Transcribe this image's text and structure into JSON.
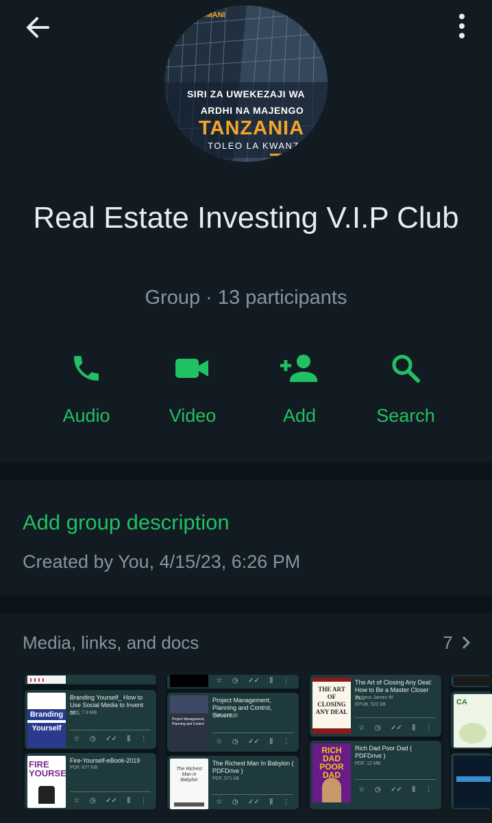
{
  "avatar": {
    "brand": "BOMANI",
    "line1": "SIRI ZA  UWEKEZAJI  WA",
    "line2": "ARDHI  NA MAJENGO",
    "line3": "TANZANIA",
    "line4": "TOLEO LA KWANZ"
  },
  "group": {
    "title": "Real Estate Investing V.I.P Club",
    "subtitle": "Group · 13 participants"
  },
  "actions": [
    {
      "label": "Audio",
      "icon": "phone-icon"
    },
    {
      "label": "Video",
      "icon": "video-camera-icon"
    },
    {
      "label": "Add",
      "icon": "add-person-icon"
    },
    {
      "label": "Search",
      "icon": "search-icon"
    }
  ],
  "description": {
    "add_label": "Add group description",
    "created": "Created by You, 4/15/23, 6:26 PM"
  },
  "media": {
    "title": "Media, links, and docs",
    "count": "7",
    "docs": [
      {
        "name": "Branding Yourself_ How to Use Social Media to Invent or...",
        "meta": "PDF, 7.9 MB",
        "cover_text": "Branding Yourself"
      },
      {
        "name": "Fire-Yourself-eBook-2019",
        "meta": "PDF, 677 KB",
        "cover_text": "FIRE YOURSELF"
      },
      {
        "name": "Project Management, Planning and Control, Sevent...",
        "meta": "PDF, 17 MB",
        "cover_text": "Project Management, Planning and Control"
      },
      {
        "name": "The Richest Man In Babylon ( PDFDrive )",
        "meta": "PDF, 571 kB",
        "cover_text": "The Richest Man in Babylon"
      },
      {
        "name": "The Art of Closing Any Deal: How to Be a Master Closer in...",
        "meta": "Pickens James W.",
        "meta2": "EPUB, 522 kB",
        "cover_text": "THE ART OF CLOSING ANY DEAL"
      },
      {
        "name": "Rich Dad Poor Dad ( PDFDrive )",
        "meta": "PDF, 12 MB",
        "cover_text": "RICH DAD POOR DAD"
      },
      {
        "name": "",
        "meta": "",
        "cover_text": "CA"
      }
    ]
  },
  "colors": {
    "accent": "#21c063",
    "background": "#0b141a",
    "panel": "#111b21",
    "muted": "#8696a0"
  }
}
